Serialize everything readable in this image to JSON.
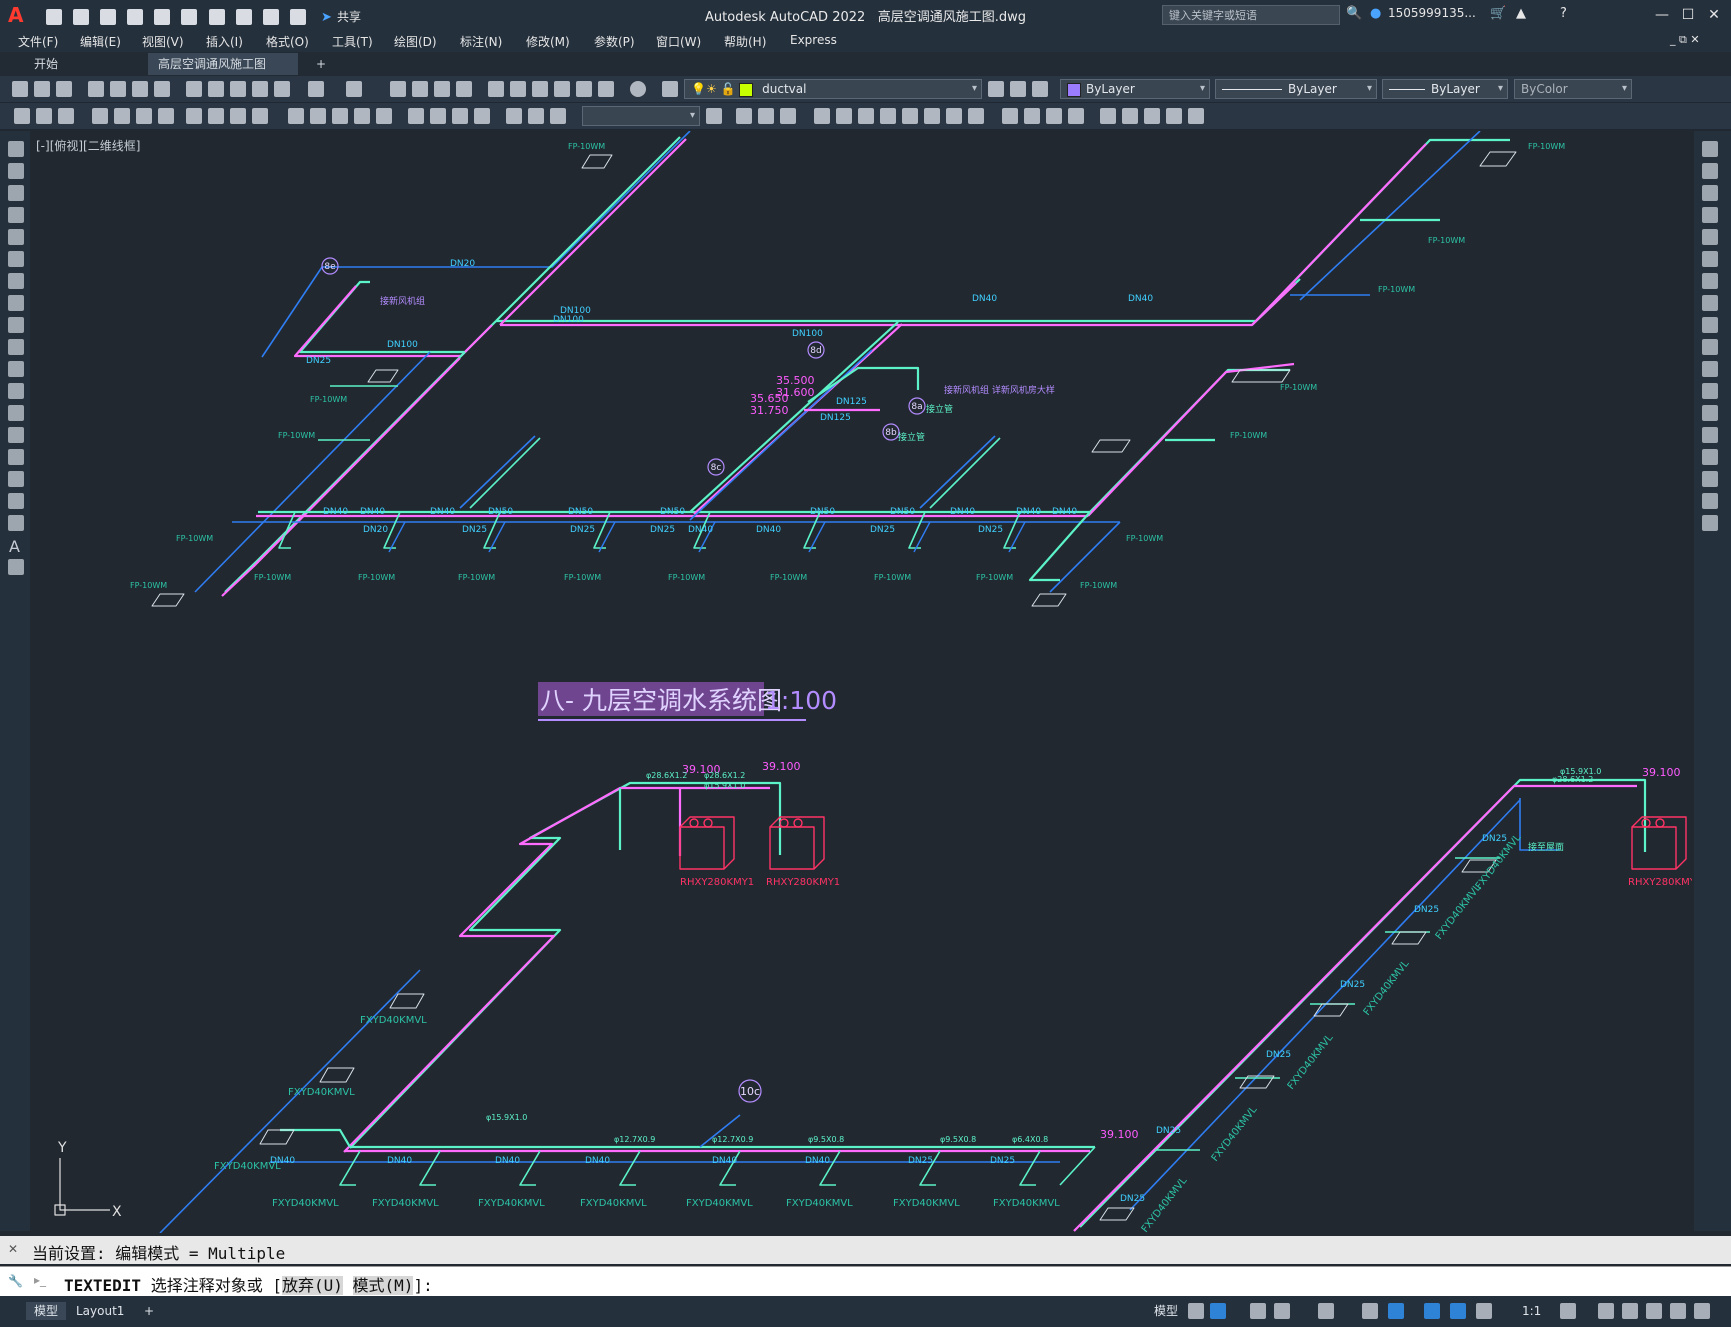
{
  "app": {
    "title": "Autodesk AutoCAD 2022",
    "filename": "高层空调通风施工图.dwg",
    "search_placeholder": "键入关键字或短语",
    "user": "1505999135...",
    "share_label": "共享"
  },
  "menu": [
    "文件(F)",
    "编辑(E)",
    "视图(V)",
    "插入(I)",
    "格式(O)",
    "工具(T)",
    "绘图(D)",
    "标注(N)",
    "修改(M)",
    "参数(P)",
    "窗口(W)",
    "帮助(H)",
    "Express"
  ],
  "tabs": {
    "start": "开始",
    "doc": "高层空调通风施工图*"
  },
  "properties": {
    "layer": "ductval",
    "color": "ByLayer",
    "linetype": "ByLayer",
    "lineweight": "ByLayer",
    "plotstyle": "ByColor",
    "layer_color": "#c8ff00",
    "prop_color": "#9b7cff"
  },
  "viewport": {
    "label": "[-][俯视][二维线框]"
  },
  "drawing": {
    "title_text": "八- 九层空调水系统图",
    "scale_text": "1:100",
    "labels": {
      "dn20": "DN20",
      "dn25": "DN25",
      "dn32": "DN32",
      "dn40": "DN40",
      "dn50": "DN50",
      "dn80": "DN80",
      "dn100": "DN100",
      "dn125": "DN125",
      "fp": "FP-10WM",
      "fxyd": "FXYD40KMVL",
      "rhxy": "RHXY280KMY1",
      "elev1": "39.100",
      "elev2": "35.500",
      "elev3": "31.600",
      "elev4": "35.650",
      "elev5": "31.750",
      "pipe1": "φ28.6X1.2",
      "pipe2": "φ15.9X1.0",
      "pipe3": "φ12.7X0.9",
      "pipe4": "φ9.5X0.8",
      "pipe5": "φ6.4X0.8",
      "tag_8e": "8e",
      "tag_8d": "8d",
      "tag_8c": "8c",
      "tag_8b": "8b",
      "tag_8a": "8a",
      "tag_10c": "10c",
      "note1": "接新风机组 详新风机房大样",
      "note2": "接新风机组",
      "note3": "接立管",
      "note4": "接立管",
      "note5": "接至屋面"
    }
  },
  "command": {
    "history": "当前设置: 编辑模式 = Multiple",
    "prompt_cmd": "TEXTEDIT",
    "prompt_text": "选择注释对象或",
    "opt1": "放弃(U)",
    "opt2": "模式(M)",
    "tail": "]:"
  },
  "status": {
    "model_tab": "模型",
    "layout_tab": "Layout1",
    "model_btn": "模型",
    "scale": "1:1"
  },
  "colors": {
    "pipe_cyan": "#5cf3c8",
    "pipe_magenta": "#ff6cff",
    "pipe_blue": "#2f7df2",
    "text_cyan": "#40d0ff",
    "text_teal": "#2cc3a6",
    "red_unit": "#ff3366",
    "title_purple": "#8a4fb0"
  }
}
